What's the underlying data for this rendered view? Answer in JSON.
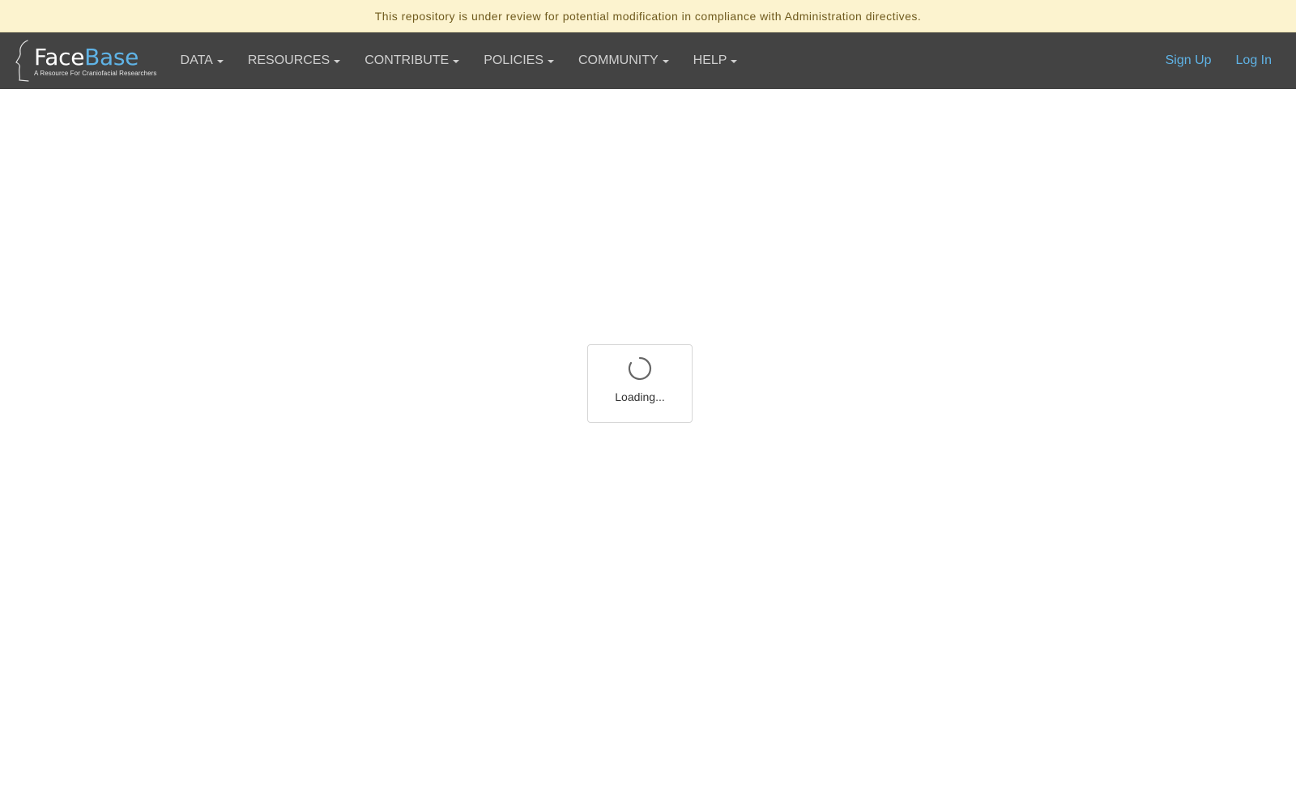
{
  "notice": {
    "text": "This repository is under review for potential modification in compliance with Administration directives."
  },
  "brand": {
    "name_part1": "Face",
    "name_part2": "Base",
    "tagline": "A Resource For Craniofacial Researchers",
    "colors": {
      "accent": "#5fb3e6",
      "navbar": "#434343",
      "notice_bg": "#fcf3cf"
    }
  },
  "nav": {
    "items": [
      {
        "label": "DATA"
      },
      {
        "label": "RESOURCES"
      },
      {
        "label": "CONTRIBUTE"
      },
      {
        "label": "POLICIES"
      },
      {
        "label": "COMMUNITY"
      },
      {
        "label": "HELP"
      }
    ],
    "sign_up": "Sign Up",
    "log_in": "Log In"
  },
  "loading": {
    "text": "Loading...",
    "icon": "spinner-icon"
  }
}
